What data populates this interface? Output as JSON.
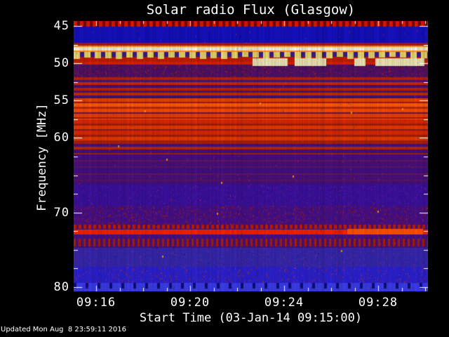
{
  "title": "Solar radio Flux (Glasgow)",
  "x_axis": {
    "label": "Start Time (03-Jan-14 09:15:00)",
    "tick_labels": [
      "09:16",
      "09:20",
      "09:24",
      "09:28"
    ]
  },
  "y_axis": {
    "label": "Frequency [MHz]",
    "tick_labels": [
      "45",
      "50",
      "55",
      "60",
      "70",
      "80"
    ]
  },
  "footer": {
    "updated_text": "Updated Mon Aug  8 23:59:11 2016"
  },
  "colors": {
    "background": "#000000",
    "text": "#ffffff",
    "tick": "#ffffff"
  },
  "chart_data": {
    "type": "heatmap",
    "subtype": "radio-spectrogram",
    "title": "Solar radio Flux (Glasgow)",
    "xlabel": "Start Time (03-Jan-14 09:15:00)",
    "ylabel": "Frequency [MHz]",
    "x_start_time": "09:15:00",
    "x_end_time": "09:30:00",
    "x_major_ticks": [
      {
        "label": "09:16",
        "minute": 1
      },
      {
        "label": "09:20",
        "minute": 5
      },
      {
        "label": "09:24",
        "minute": 9
      },
      {
        "label": "09:28",
        "minute": 13
      }
    ],
    "x_minor_step_minutes": 1,
    "y_major_ticks": [
      45,
      50,
      55,
      60,
      70,
      80
    ],
    "y_minor_ticks": [
      47.5,
      52.5,
      57.5,
      62.5,
      65,
      67.5,
      72.5,
      75,
      77.5
    ],
    "y_range_mhz": [
      44.3,
      80.6
    ],
    "y_axis_inverted": true,
    "colormap": "blue(low) -> purple -> red -> orange -> yellow/white(high)",
    "summary": "Horizontal RFI bands dominate: strong white/yellow interference near 48-50 MHz, intense red-orange band group 52-62 MHz, bright carrier line at ~72.5 MHz, quiet blue regions 45-47 MHz and 77-80 MHz.",
    "bands": [
      {
        "f0": 44.3,
        "f1": 45.1,
        "style": "vdash",
        "base": "#700707",
        "dash": "#dd1a00",
        "dw": 5,
        "dg": 4,
        "frac": 1
      },
      {
        "f0": 45.1,
        "f1": 47.3,
        "style": "noisecol",
        "base": "#1913c9",
        "alt": "#0d0a9e"
      },
      {
        "f0": 47.3,
        "f1": 47.6,
        "style": "solid",
        "base": "#aa1e00"
      },
      {
        "f0": 47.6,
        "f1": 48.5,
        "style": "bright",
        "base": "#ff9718",
        "core": "#f4eec6"
      },
      {
        "f0": 48.5,
        "f1": 49.8,
        "style": "checker",
        "base": "#c41d00",
        "dash": "#e8d66e",
        "gapc": "#3b1d8e",
        "dw": 9,
        "dg": 6
      },
      {
        "f0": 49.8,
        "f1": 50.2,
        "style": "solid",
        "base": "#dc2300"
      },
      {
        "f0": 50.2,
        "f1": 51.9,
        "style": "speckle",
        "base": "#4d1168",
        "dot": "#a81e10",
        "density": 0.1
      },
      {
        "f0": 51.9,
        "f1": 54.7,
        "style": "hstripes",
        "rows": [
          [
            "#bf2104",
            4
          ],
          [
            "#511277",
            3
          ],
          [
            "#c92a02",
            4
          ],
          [
            "#47107c",
            4
          ]
        ]
      },
      {
        "f0": 54.7,
        "f1": 57.5,
        "style": "hstripes",
        "rows": [
          [
            "#ee4102",
            5
          ],
          [
            "#a81b10",
            2
          ],
          [
            "#ff5d07",
            5
          ],
          [
            "#c52a03",
            3
          ],
          [
            "#fa4a04",
            5
          ],
          [
            "#6e1342",
            2
          ]
        ]
      },
      {
        "f0": 57.5,
        "f1": 60.3,
        "style": "hstripes",
        "rows": [
          [
            "#dd2801",
            6
          ],
          [
            "#a81f05",
            3
          ],
          [
            "#ea3a02",
            5
          ],
          [
            "#911b15",
            2
          ]
        ]
      },
      {
        "f0": 60.3,
        "f1": 62.2,
        "style": "hstripes",
        "rows": [
          [
            "#ad2008",
            5
          ],
          [
            "#4c1179",
            4
          ],
          [
            "#bf2505",
            4
          ],
          [
            "#43107f",
            5
          ]
        ]
      },
      {
        "f0": 62.2,
        "f1": 66.3,
        "style": "hstripes",
        "rows": [
          [
            "#441082",
            8
          ],
          [
            "#691560",
            2
          ],
          [
            "#4a117b",
            7
          ],
          [
            "#5d1465",
            2
          ]
        ]
      },
      {
        "f0": 66.3,
        "f1": 69.1,
        "style": "speckle",
        "base": "#3a119c",
        "dot": "#6f17a5",
        "density": 0.05
      },
      {
        "f0": 69.1,
        "f1": 71.6,
        "style": "speckle",
        "base": "#45108b",
        "dot": "#a81e10",
        "density": 0.09
      },
      {
        "f0": 71.6,
        "f1": 72.3,
        "style": "vdash",
        "base": "#4a1080",
        "dash": "#bb2000",
        "dw": 4,
        "dg": 3,
        "frac": 0.8
      },
      {
        "f0": 72.3,
        "f1": 72.9,
        "style": "solid",
        "base": "#f32400"
      },
      {
        "f0": 72.9,
        "f1": 73.5,
        "style": "speckle",
        "base": "#45108b",
        "dot": "#9c1c10",
        "density": 0.06
      },
      {
        "f0": 73.5,
        "f1": 74.7,
        "style": "vdash",
        "base": "#4c1179",
        "dash": "#aa2005",
        "dw": 3,
        "dg": 4,
        "frac": 0.85
      },
      {
        "f0": 74.7,
        "f1": 77.3,
        "style": "speckle",
        "base": "#3527ad",
        "dot": "#5c2f9d",
        "density": 0.07
      },
      {
        "f0": 77.3,
        "f1": 79.4,
        "style": "speckle",
        "base": "#2b21d0",
        "dot": "#b23020",
        "density": 0.04
      },
      {
        "f0": 79.4,
        "f1": 80.6,
        "style": "vdash",
        "base": "#3b3cee",
        "dash": "#0d0d7a",
        "dw": 4,
        "dg": 13,
        "frac": 0.65
      }
    ],
    "features": [
      {
        "type": "hseg",
        "f": 72.25,
        "h": 8,
        "x_min": 11.69,
        "w_min": 3.22,
        "color": "#ff5200",
        "desc": "brighter thicker segment of 72.5 MHz carrier line"
      },
      {
        "type": "blocks",
        "f": 49.3,
        "h": 11,
        "color": "#eee6b4",
        "items": [
          [
            7.66,
            1.49
          ],
          [
            9.45,
            1.34
          ],
          [
            11.99,
            0.48
          ],
          [
            12.88,
            2.09
          ]
        ],
        "desc": "pale saturated interference blocks near 49.5 MHz"
      }
    ]
  }
}
